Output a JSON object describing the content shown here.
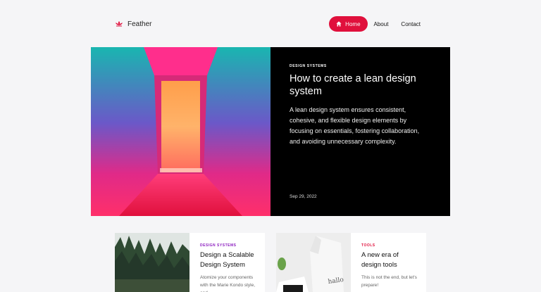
{
  "brand": {
    "name": "Feather",
    "icon": "lotus-icon",
    "accent": "#e0103c"
  },
  "nav": {
    "items": [
      {
        "label": "Home",
        "active": true,
        "icon": "home-icon"
      },
      {
        "label": "About",
        "active": false
      },
      {
        "label": "Contact",
        "active": false
      }
    ]
  },
  "hero": {
    "eyebrow": "Design Systems",
    "title": "How to create a lean design system",
    "excerpt": "A lean design system ensures consistent, cohesive, and flexible design elements by focusing on essentials, fostering collaboration, and avoiding unnecessary complexity.",
    "date": "Sep 29, 2022"
  },
  "cards": [
    {
      "eyebrow": "Design Systems",
      "eyebrow_color": "#8b1bbf",
      "title": "Design a Scalable Design System",
      "excerpt": "Atomize your components with the Marie Kondo style, and"
    },
    {
      "eyebrow": "Tools",
      "eyebrow_color": "#e0103c",
      "title": "A new era of design tools",
      "excerpt": "This is not the end, but let's prepare!"
    }
  ],
  "colors": {
    "background": "#f5f5f7",
    "hero_bg": "#000000",
    "accent": "#e0103c"
  }
}
